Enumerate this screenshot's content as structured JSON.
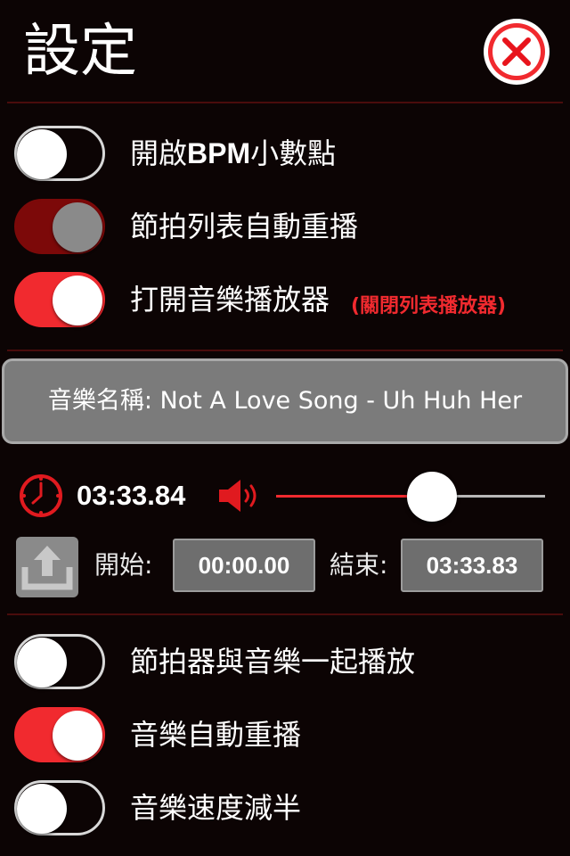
{
  "header": {
    "title": "設定",
    "close_icon": "close-x-circle-icon"
  },
  "settings_top": [
    {
      "label_prefix": "開啟",
      "label_bold": "BPM",
      "label_suffix": "小數點",
      "state": "off"
    },
    {
      "label": "節拍列表自動重播",
      "state": "disabled-on"
    },
    {
      "label": "打開音樂播放器",
      "note": "(關閉列表播放器)",
      "state": "on"
    }
  ],
  "music": {
    "name_label": "音樂名稱: Not A Love Song - Uh Huh Her"
  },
  "playback": {
    "clock_icon": "clock-icon",
    "current_time": "03:33.84",
    "speaker_icon": "speaker-volume-icon",
    "volume_level": 0.58
  },
  "range": {
    "export_icon": "upload-share-icon",
    "start_label": "開始:",
    "start_value": "00:00.00",
    "end_label": "結束:",
    "end_value": "03:33.83"
  },
  "settings_bottom": [
    {
      "label": "節拍器與音樂一起播放",
      "state": "off"
    },
    {
      "label": "音樂自動重播",
      "state": "on"
    },
    {
      "label": "音樂速度減半",
      "state": "off"
    }
  ],
  "colors": {
    "accent": "#f12a2f",
    "background": "#0c0404",
    "disabled_on": "#7c0909",
    "panel": "#7b7b7b"
  }
}
